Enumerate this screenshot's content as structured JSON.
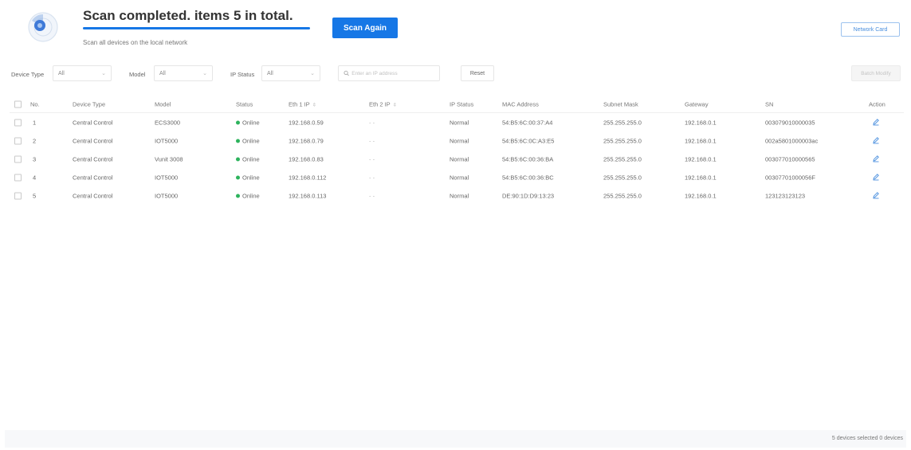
{
  "header": {
    "title": "Scan completed. items 5 in total.",
    "subtitle": "Scan all devices on the local network",
    "scan_again_label": "Scan Again",
    "network_card_label": "Network Card",
    "progress_percent": 100
  },
  "filters": {
    "device_type_label": "Device Type",
    "device_type_value": "All",
    "model_label": "Model",
    "model_value": "All",
    "ip_status_label": "IP Status",
    "ip_status_value": "All",
    "search_placeholder": "Enter an IP address",
    "reset_label": "Reset",
    "batch_label": "Batch Modify"
  },
  "table": {
    "columns": [
      "No.",
      "Device Type",
      "Model",
      "Status",
      "Eth 1 IP",
      "Eth 2 IP",
      "IP Status",
      "MAC Address",
      "Subnet Mask",
      "Gateway",
      "SN",
      "Action"
    ],
    "rows": [
      {
        "no": "1",
        "device_type": "Central Control",
        "model": "ECS3000",
        "status": "Online",
        "eth1": "192.168.0.59",
        "eth2": "- -",
        "ip_status": "Normal",
        "mac": "54:B5:6C:00:37:A4",
        "subnet": "255.255.255.0",
        "gateway": "192.168.0.1",
        "sn": "003079010000035"
      },
      {
        "no": "2",
        "device_type": "Central Control",
        "model": "IOT5000",
        "status": "Online",
        "eth1": "192.168.0.79",
        "eth2": "- -",
        "ip_status": "Normal",
        "mac": "54:B5:6C:0C:A3:E5",
        "subnet": "255.255.255.0",
        "gateway": "192.168.0.1",
        "sn": "002a5801000003ac"
      },
      {
        "no": "3",
        "device_type": "Central Control",
        "model": "Vunit 3008",
        "status": "Online",
        "eth1": "192.168.0.83",
        "eth2": "- -",
        "ip_status": "Normal",
        "mac": "54:B5:6C:00:36:BA",
        "subnet": "255.255.255.0",
        "gateway": "192.168.0.1",
        "sn": "003077010000565"
      },
      {
        "no": "4",
        "device_type": "Central Control",
        "model": "IOT5000",
        "status": "Online",
        "eth1": "192.168.0.112",
        "eth2": "- -",
        "ip_status": "Normal",
        "mac": "54:B5:6C:00:36:BC",
        "subnet": "255.255.255.0",
        "gateway": "192.168.0.1",
        "sn": "00307701000056F"
      },
      {
        "no": "5",
        "device_type": "Central Control",
        "model": "IOT5000",
        "status": "Online",
        "eth1": "192.168.0.113",
        "eth2": "- -",
        "ip_status": "Normal",
        "mac": "DE:90:1D:D9:13:23",
        "subnet": "255.255.255.0",
        "gateway": "192.168.0.1",
        "sn": "123123123123"
      }
    ]
  },
  "footer": {
    "summary": "5 devices selected 0 devices"
  },
  "colors": {
    "accent": "#1677e6",
    "online": "#2db35d"
  }
}
